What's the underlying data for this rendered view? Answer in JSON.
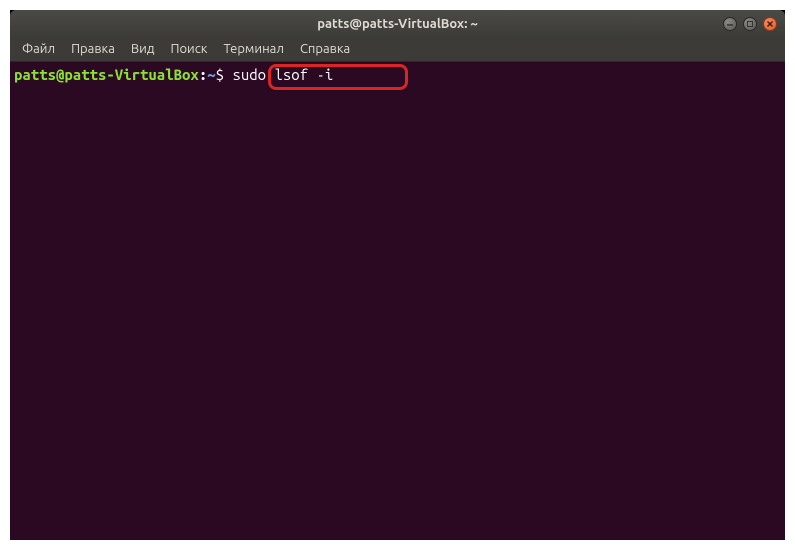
{
  "window": {
    "title": "patts@patts-VirtualBox: ~"
  },
  "menu": {
    "file": "Файл",
    "edit": "Правка",
    "view": "Вид",
    "search": "Поиск",
    "terminal": "Терминал",
    "help": "Справка"
  },
  "prompt": {
    "user_host": "patts@patts-VirtualBox",
    "colon": ":",
    "path": "~",
    "dollar": "$ ",
    "command": "sudo lsof -i"
  }
}
